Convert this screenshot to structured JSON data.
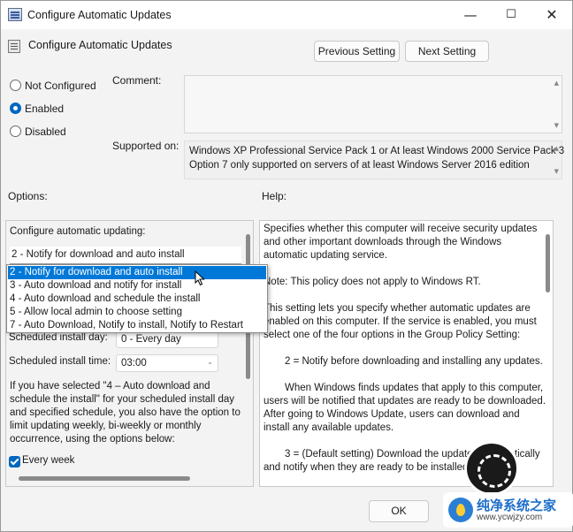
{
  "window": {
    "title": "Configure Automatic Updates",
    "controls": {
      "minimize": "—",
      "maximize": "☐",
      "close": "✕"
    }
  },
  "header": {
    "title": "Configure Automatic Updates",
    "prev_button": "Previous Setting",
    "next_button": "Next Setting"
  },
  "state": {
    "options": [
      {
        "label": "Not Configured",
        "selected": false
      },
      {
        "label": "Enabled",
        "selected": true
      },
      {
        "label": "Disabled",
        "selected": false
      }
    ]
  },
  "comment": {
    "label": "Comment:",
    "value": ""
  },
  "supported": {
    "label": "Supported on:",
    "lines": [
      "Windows XP Professional Service Pack 1 or At least Windows 2000 Service Pack 3",
      "Option 7 only supported on servers of at least Windows Server 2016 edition"
    ]
  },
  "options_section": {
    "label": "Options:",
    "configure_label": "Configure automatic updating:",
    "combo_value": "2 - Notify for download and auto install",
    "dropdown_items": [
      "2 - Notify for download and auto install",
      "3 - Auto download and notify for install",
      "4 - Auto download and schedule the install",
      "5 - Allow local admin to choose setting",
      "7 - Auto Download, Notify to install, Notify to Restart"
    ],
    "dropdown_selected_index": 0,
    "install_day_label": "Scheduled install day:",
    "install_day_value": "0 - Every day",
    "install_time_label": "Scheduled install time:",
    "install_time_value": "03:00",
    "paragraph": "If you have selected \"4 – Auto download and schedule the install\" for your scheduled install day and specified schedule, you also have the option to limit updating weekly, bi-weekly or monthly occurrence, using the options below:",
    "every_week_label": "Every week",
    "every_week_checked": true
  },
  "help_section": {
    "label": "Help:",
    "paragraphs": [
      "Specifies whether this computer will receive security updates and other important downloads through the Windows automatic updating service.",
      "Note: This policy does not apply to Windows RT.",
      "This setting lets you specify whether automatic updates are enabled on this computer. If the service is enabled, you must select one of the four options in the Group Policy Setting:",
      "2 = Notify before downloading and installing any updates.",
      "When Windows finds updates that apply to this computer, users will be notified that updates are ready to be downloaded. After going to Windows Update, users can download and install any available updates.",
      "3 = (Default setting) Download the updates automatically and notify when they are ready to be installed"
    ]
  },
  "footer": {
    "ok_button": "OK"
  },
  "watermark": {
    "text": "纯净系统之家",
    "url": "www.ycwjzy.com"
  }
}
